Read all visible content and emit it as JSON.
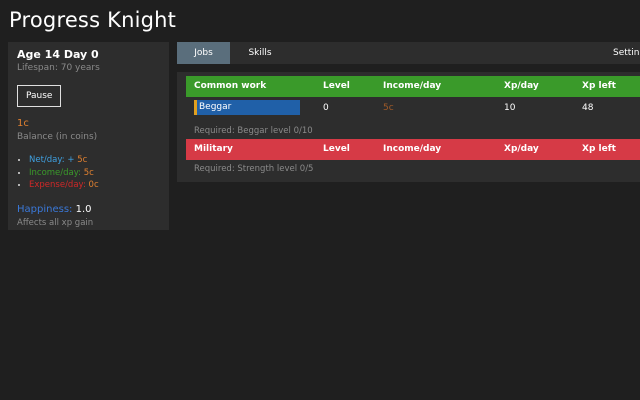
{
  "app": {
    "title": "Progress Knight"
  },
  "sidebar": {
    "age_label": "Age 14 Day 0",
    "lifespan": "Lifespan: 70 years",
    "pause_label": "Pause",
    "coins": "1c",
    "balance_label": "Balance (in coins)",
    "stats": {
      "netday_label": "Net/day:",
      "netday_sign": "+",
      "netday_value": "5c",
      "income_label": "Income/day:",
      "income_value": "5c",
      "expense_label": "Expense/day:",
      "expense_value": "0c"
    },
    "happiness_label": "Happiness:",
    "happiness_value": "1.0",
    "happiness_note": "Affects all xp gain"
  },
  "tabs": {
    "jobs": "Jobs",
    "skills": "Skills",
    "settings": "Settings"
  },
  "jobs": {
    "common_header": [
      "Common work",
      "Level",
      "Income/day",
      "Xp/day",
      "Xp left"
    ],
    "beggar": {
      "name": "Beggar",
      "level": "0",
      "income": "5c",
      "xp_day": "10",
      "xp_left": "48",
      "progress": 0.0
    },
    "common_required": "Required: Beggar level 0/10",
    "military_header": [
      "Military",
      "Level",
      "Income/day",
      "Xp/day",
      "Xp left"
    ],
    "military_required": "Required: Strength level 0/5"
  },
  "colors": {
    "background": "#1f1f1f",
    "panel": "#2d2d2d",
    "common_header": "#3a9a2a",
    "military_header": "#d63a46",
    "progress_bar": "#2060a8",
    "active_tab": "#5a6e7c"
  }
}
